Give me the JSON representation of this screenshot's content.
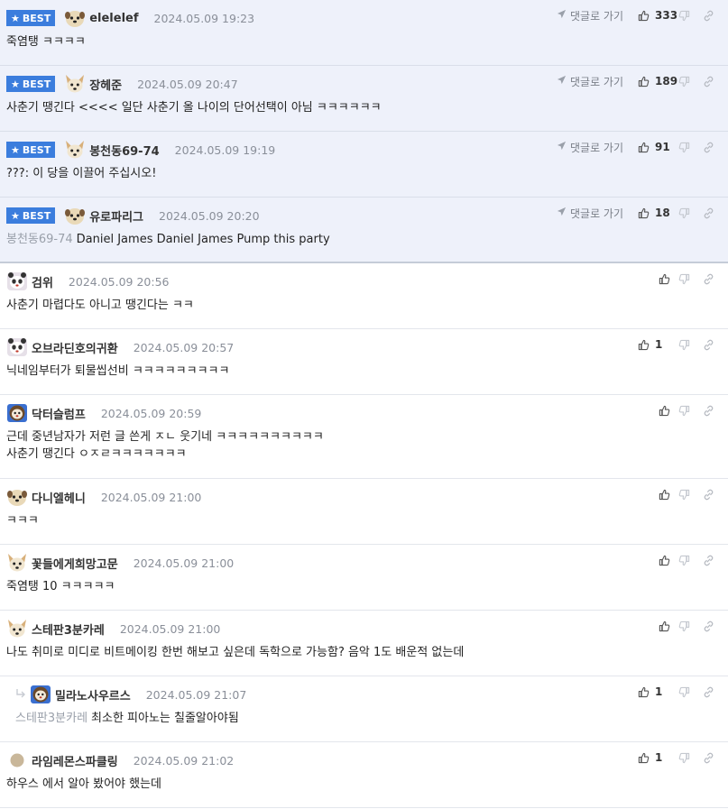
{
  "badge_label": "BEST",
  "goto_label": "댓글로 가기",
  "colors": {
    "accent": "#3b7ddd",
    "best_bg": "#eef1fa"
  },
  "best_comments": [
    {
      "nick": "elelelef",
      "date": "2024.05.09 19:23",
      "likes": "333",
      "lines": [
        "죽염탱 ㅋㅋㅋㅋ"
      ],
      "avatar": "dog-face-icon"
    },
    {
      "nick": "장헤준",
      "date": "2024.05.09 20:47",
      "likes": "189",
      "lines": [
        "사춘기 땡긴다 <<<< 일단 사춘기 올 나이의 단어선택이 아님 ㅋㅋㅋㅋㅋㅋ"
      ],
      "avatar": "fox-face-icon"
    },
    {
      "nick": "봉천동69-74",
      "date": "2024.05.09 19:19",
      "likes": "91",
      "lines": [
        "???: 이 당을 이끌어 주십시오!"
      ],
      "avatar": "fox-face-icon"
    },
    {
      "nick": "유로파리그",
      "date": "2024.05.09 20:20",
      "likes": "18",
      "mention": "봉천동69-74",
      "lines": [
        "Daniel James Daniel James Pump this party"
      ],
      "avatar": "dog-face-icon"
    }
  ],
  "comments": [
    {
      "nick": "검위",
      "date": "2024.05.09 20:56",
      "likes": "",
      "lines": [
        "사춘기 마렵다도 아니고 땡긴다는 ㅋㅋ"
      ],
      "avatar": "panda-face-icon"
    },
    {
      "nick": "오브라딘호의귀환",
      "date": "2024.05.09 20:57",
      "likes": "1",
      "lines": [
        "닉네임부터가 퇴물씹선비 ㅋㅋㅋㅋㅋㅋㅋㅋㅋ"
      ],
      "avatar": "panda-face-icon"
    },
    {
      "nick": "닥터슬럼프",
      "date": "2024.05.09 20:59",
      "likes": "",
      "lines": [
        "근데 중년남자가 저런 글 쓴게 ㅈㄴ 웃기네 ㅋㅋㅋㅋㅋㅋㅋㅋㅋㅋ",
        "사춘기 땡긴다 ㅇㅈㄹㅋㅋㅋㅋㅋㅋㅋ"
      ],
      "avatar": "lion-face-icon"
    },
    {
      "nick": "다니엘헤니",
      "date": "2024.05.09 21:00",
      "likes": "",
      "lines": [
        "ㅋㅋㅋ"
      ],
      "avatar": "dog-face-icon"
    },
    {
      "nick": "꽃들에게희망고문",
      "date": "2024.05.09 21:00",
      "likes": "",
      "lines": [
        "죽염탱 10 ㅋㅋㅋㅋㅋ"
      ],
      "avatar": "fox-face-icon"
    },
    {
      "nick": "스테판3분카레",
      "date": "2024.05.09 21:00",
      "likes": "",
      "lines": [
        "나도 취미로 미디로 비트메이킹 한번 해보고 싶은데 독학으로 가능함? 음악 1도 배운적 없는데"
      ],
      "avatar": "fox-face-icon"
    },
    {
      "nick": "밀라노사우르스",
      "date": "2024.05.09 21:07",
      "likes": "1",
      "reply": true,
      "mention": "스테판3분카레",
      "lines": [
        "최소한 피아노는 칠줄알아야됨"
      ],
      "avatar": "lion-face-icon"
    },
    {
      "nick": "라임레몬스파클링",
      "date": "2024.05.09 21:02",
      "likes": "1",
      "lines": [
        "하우스 에서 알아 봤어야 했는데"
      ],
      "avatar": "default-avatar-icon"
    }
  ]
}
